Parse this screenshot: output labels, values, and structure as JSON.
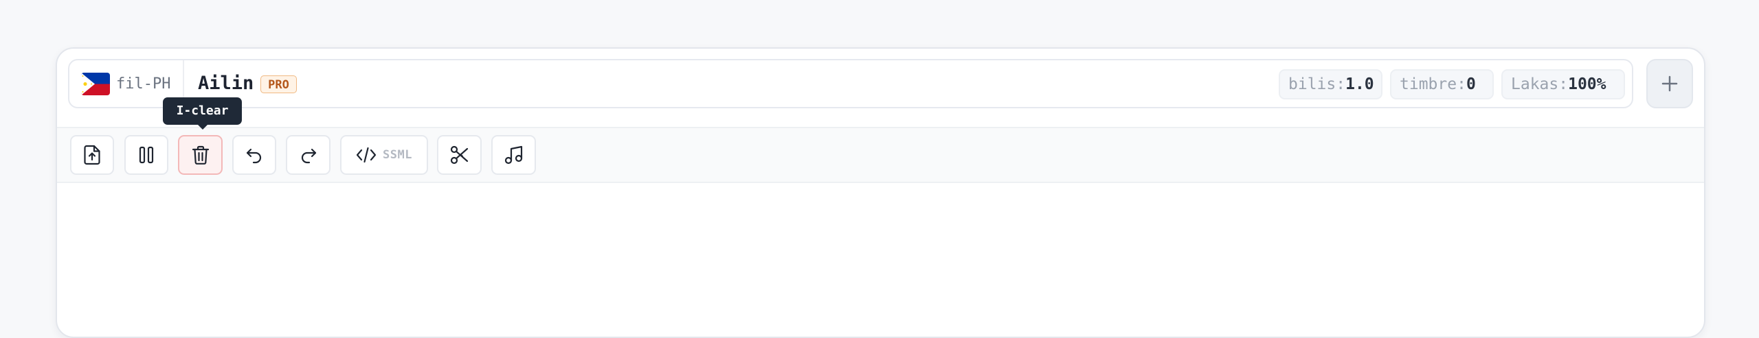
{
  "voice": {
    "locale": "fil-PH",
    "flag_icon": "philippines-flag-icon",
    "name": "Ailin",
    "badge": "PRO"
  },
  "params": [
    {
      "key": "bilis:",
      "value": "1.0"
    },
    {
      "key": "timbre:",
      "value": "0"
    },
    {
      "key": "Lakas:",
      "value": "100%"
    }
  ],
  "add_button": {
    "icon": "plus-icon"
  },
  "toolbar": {
    "buttons": [
      {
        "icon": "file-upload-icon"
      },
      {
        "icon": "pause-icon"
      },
      {
        "icon": "trash-icon",
        "active": true
      },
      {
        "icon": "undo-icon"
      },
      {
        "icon": "redo-icon"
      },
      {
        "icon": "code-icon",
        "label": "SSML"
      },
      {
        "icon": "scissors-icon"
      },
      {
        "icon": "music-note-icon"
      }
    ],
    "tooltip": "I-clear"
  },
  "colors": {
    "danger_bg": "#fdf1f1",
    "danger_border": "#f3b8b8",
    "badge_text": "#b4581c",
    "tooltip_bg": "#1f2937"
  }
}
